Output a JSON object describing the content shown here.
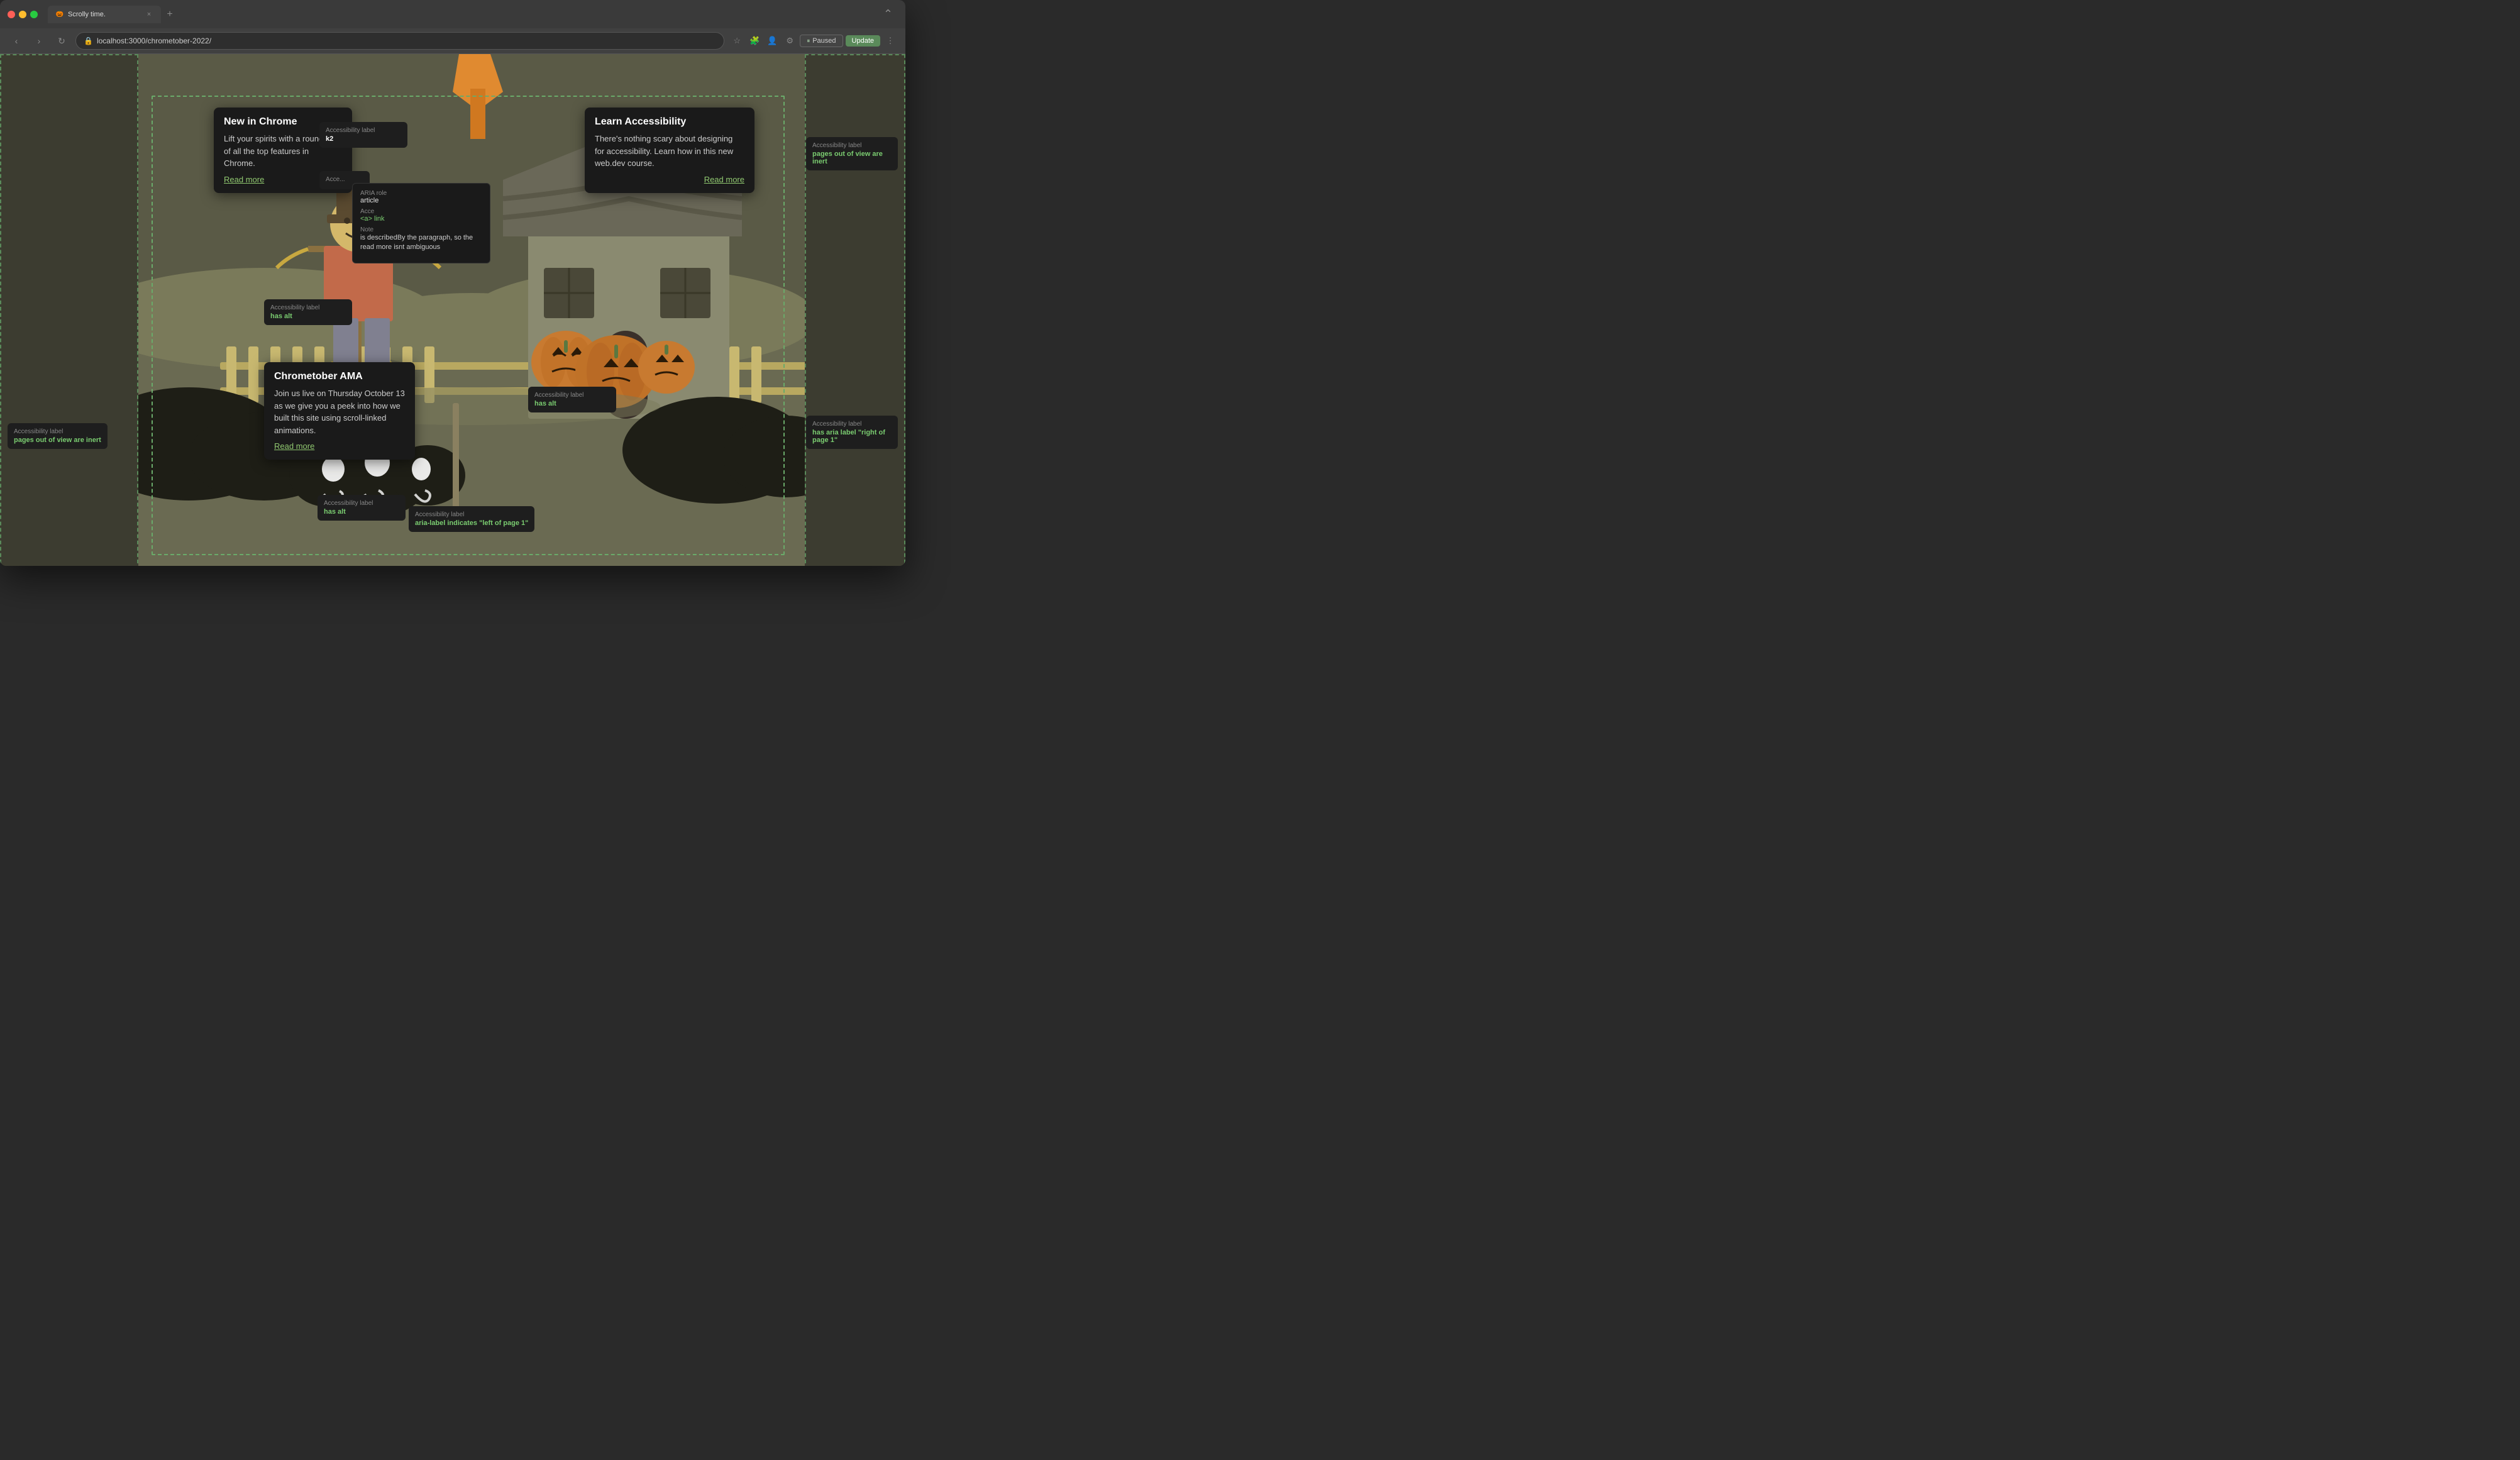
{
  "browser": {
    "tab_title": "Scrolly time.",
    "tab_favicon": "🎃",
    "url": "localhost:3000/chrometober-2022/",
    "nav": {
      "back": "‹",
      "forward": "›",
      "refresh": "↻"
    },
    "toolbar_buttons": [
      "⭐",
      "🔒",
      "⚙"
    ],
    "btn_paused": "Paused",
    "btn_update": "Update"
  },
  "cards": {
    "new_in_chrome": {
      "title": "New in Chrome",
      "body": "Lift your spirits with a round-up of all the top features in Chrome.",
      "read_more": "Read more"
    },
    "learn_accessibility": {
      "title": "Learn Accessibility",
      "body": "There's nothing scary about designing for accessibility. Learn how in this new web.dev course.",
      "read_more": "Read more"
    },
    "chrometober_ama": {
      "title": "Chrometober AMA",
      "body": "Join us live on Thursday October 13 as we give you a peek into how we built this site using scroll-linked animations.",
      "read_more": "Read more"
    }
  },
  "a11y_labels": {
    "has_alt": "has alt",
    "pages_out_of_view_left": "pages out of view are inert",
    "pages_out_of_view_right": "pages out of view are inert",
    "aria_label_right": "has aria label \"right of page 1\"",
    "aria_label_left": "aria-label indicates \"left of page 1\"",
    "accessibility_label": "Accessibility label",
    "has_aria_label": "has aria label"
  },
  "aria_popup": {
    "aria_role_label": "ARIA role",
    "aria_role_value": "article",
    "accessibility_label": "Acce...",
    "accessibility_value": "<a> link",
    "note_label": "Note",
    "note_text": "is describedBy the paragraph, so the read more isnt ambiguous"
  },
  "regions": {
    "left_label": "Accessibility label",
    "right_label": "Accessibility label"
  }
}
